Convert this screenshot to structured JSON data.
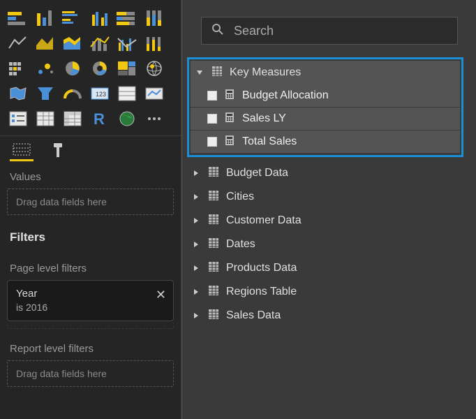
{
  "search": {
    "placeholder": "Search"
  },
  "inner_tabs": {
    "fields": "Fields",
    "format": "Format"
  },
  "values_section": {
    "label": "Values",
    "drop_text": "Drag data fields here"
  },
  "filters_section": {
    "header": "Filters",
    "page_level_label": "Page level filters",
    "report_level_label": "Report level filters",
    "drop_text": "Drag data fields here",
    "active_filter": {
      "field": "Year",
      "condition": "is 2016"
    }
  },
  "fields_tree": {
    "highlight": {
      "name": "Key Measures",
      "children": [
        {
          "label": "Budget Allocation"
        },
        {
          "label": "Sales LY"
        },
        {
          "label": "Total Sales"
        }
      ]
    },
    "tables": [
      {
        "label": "Budget Data"
      },
      {
        "label": "Cities"
      },
      {
        "label": "Customer Data"
      },
      {
        "label": "Dates"
      },
      {
        "label": "Products Data"
      },
      {
        "label": "Regions Table"
      },
      {
        "label": "Sales Data"
      }
    ]
  }
}
